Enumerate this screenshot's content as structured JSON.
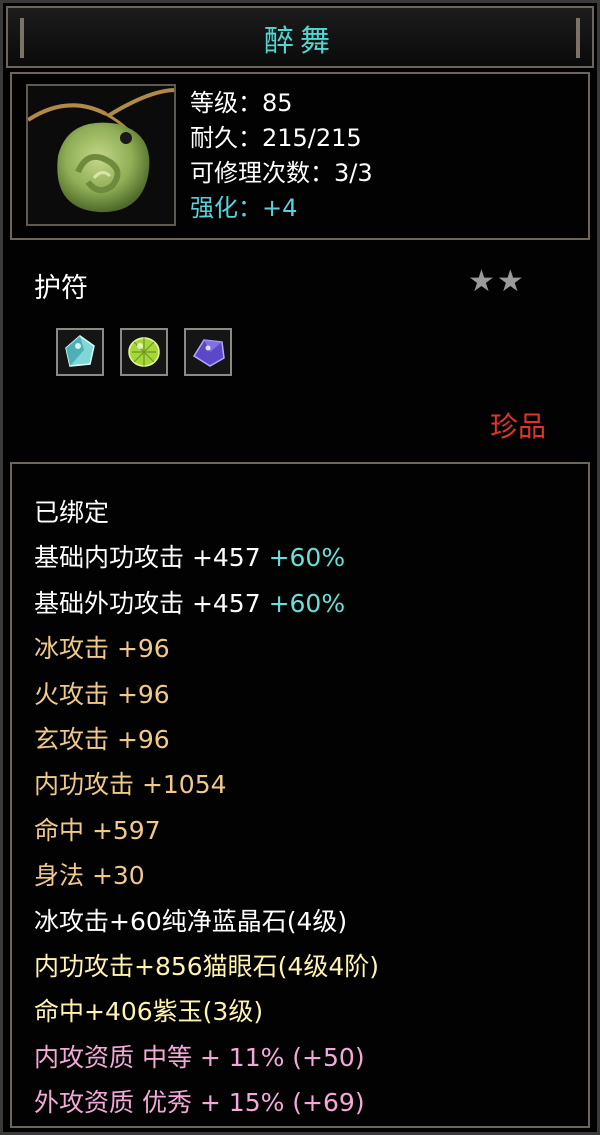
{
  "title": "醉舞",
  "stats": {
    "level": "等级：85",
    "durability": "耐久：215/215",
    "repair": "可修理次数：3/3",
    "enhance": "强化：+4"
  },
  "item_type": "护符",
  "stars": "★★",
  "gems": [
    "aqua-gem-icon",
    "green-gem-icon",
    "purple-gem-icon"
  ],
  "rarity": "珍品",
  "colors": {
    "title": "#54d6d0",
    "rarity": "#e0332b",
    "pct": "#68e0d7"
  },
  "attributes": {
    "bound": "已绑定",
    "inner_base": "基础内功攻击 +457",
    "inner_base_pct": "+60%",
    "outer_base": "基础外功攻击 +457",
    "outer_base_pct": "+60%",
    "ice": "冰攻击 +96",
    "fire": "火攻击 +96",
    "xuan": "玄攻击 +96",
    "inner_atk": "内功攻击 +1054",
    "hit": "命中 +597",
    "agility": "身法 +30",
    "gem1": "冰攻击+60纯净蓝晶石(4级)",
    "gem2": "内功攻击+856猫眼石(4级4阶)",
    "gem3": "命中+406紫玉(3级)",
    "quality1": "内攻资质 中等 + 11% (+50)",
    "quality2": "外攻资质 优秀 + 15% (+69)"
  }
}
